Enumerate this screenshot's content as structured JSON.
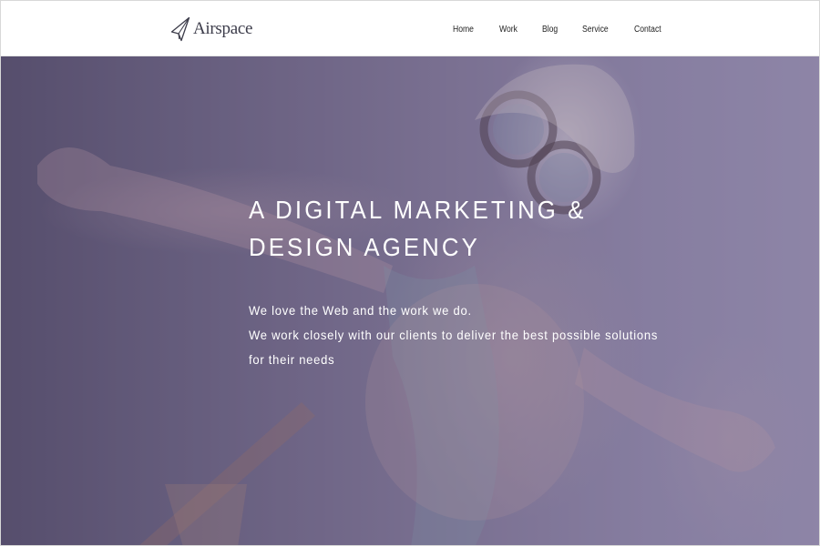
{
  "header": {
    "logo": {
      "icon": "paper-plane-icon",
      "text": "Airspace"
    },
    "nav": [
      {
        "label": "Home"
      },
      {
        "label": "Work"
      },
      {
        "label": "Blog"
      },
      {
        "label": "Service"
      },
      {
        "label": "Contact"
      }
    ]
  },
  "hero": {
    "headline_line1": "A DIGITAL MARKETING &",
    "headline_line2": "DESIGN AGENCY",
    "tagline_line1": "We love the Web and the work we do.",
    "tagline_line2": "We work closely with our clients to deliver the best possible solutions",
    "tagline_line3": "for their needs"
  },
  "colors": {
    "header_background": "#ffffff",
    "nav_text": "#222222",
    "logo_text": "#3c3c4a",
    "hero_overlay": "#7b7290",
    "hero_text": "#ffffff"
  }
}
